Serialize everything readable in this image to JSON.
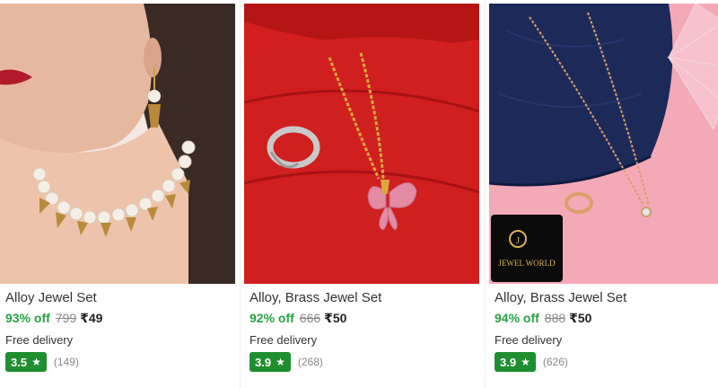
{
  "products": [
    {
      "title": "Alloy Jewel Set",
      "discount": "93% off",
      "mrp": "799",
      "price": "₹49",
      "delivery": "Free delivery",
      "rating": "3.5",
      "reviews": "(149)"
    },
    {
      "title": "Alloy, Brass Jewel Set",
      "discount": "92% off",
      "mrp": "666",
      "price": "₹50",
      "delivery": "Free delivery",
      "rating": "3.9",
      "reviews": "(268)"
    },
    {
      "title": "Alloy, Brass Jewel Set",
      "discount": "94% off",
      "mrp": "888",
      "price": "₹50",
      "delivery": "Free delivery",
      "rating": "3.9",
      "reviews": "(626)"
    }
  ],
  "brand_logo": {
    "letter": "J",
    "name": "JEWEL WORLD"
  },
  "colors": {
    "discount": "#25a244",
    "rating_badge": "#1e8e2f",
    "strike": "#888888"
  },
  "icons": {
    "rating": "star-icon"
  }
}
